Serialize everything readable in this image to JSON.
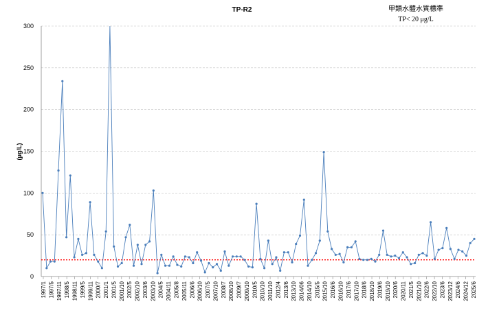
{
  "chart_data": {
    "type": "line",
    "title": "TP-R2",
    "ylabel": "(μg/L)",
    "xlabel": "",
    "ylim": [
      0,
      300
    ],
    "yticks": [
      0,
      50,
      100,
      150,
      200,
      250,
      300
    ],
    "grid": true,
    "standard_note": [
      "甲類水體水質標準",
      "TP< 20 μg/L"
    ],
    "standard_line": {
      "value": 20
    },
    "colors": {
      "series": "#4a7ebb",
      "standard": "#ff0000",
      "grid": "#c0c0c0"
    },
    "x_tick_labels": [
      "1997/1",
      "1997/5",
      "1997/11",
      "1998/5",
      "1998/11",
      "1999/5",
      "1999/11",
      "2000/7",
      "2001/1",
      "2001/5",
      "2001/10",
      "2002/5",
      "2002/10",
      "2003/6",
      "2003/10",
      "2004/5",
      "2004/11",
      "2005/8",
      "2005/11",
      "2006/6",
      "2006/10",
      "2007/5",
      "2007/10",
      "2008/7",
      "2008/10",
      "2009/7",
      "2009/10",
      "2010/5",
      "2010/10",
      "2011/10",
      "2012/4",
      "2013/6",
      "2013/10",
      "2014/06",
      "2014/10",
      "2015/5",
      "2015/10",
      "2016/6",
      "2016/10",
      "2017/6",
      "2017/10",
      "2018/6",
      "2018/10",
      "2019/6",
      "2019/10",
      "2020/6",
      "2020/11",
      "2021/5",
      "2021/10",
      "2022/6",
      "2022/10",
      "2023/6",
      "2023/12",
      "2024/6",
      "2024/12",
      "2025/6"
    ],
    "values": [
      100,
      10,
      18,
      18,
      127,
      234,
      47,
      121,
      23,
      45,
      26,
      28,
      89,
      26,
      18,
      10,
      54,
      340,
      36,
      12,
      16,
      47,
      62,
      13,
      38,
      15,
      38,
      42,
      103,
      4,
      26,
      13,
      13,
      24,
      14,
      12,
      24,
      23,
      16,
      29,
      19,
      5,
      16,
      11,
      15,
      7,
      30,
      13,
      24,
      24,
      24,
      20,
      12,
      11,
      87,
      21,
      10,
      43,
      15,
      23,
      7,
      29,
      29,
      17,
      39,
      49,
      92,
      13,
      20,
      28,
      43,
      149,
      54,
      33,
      26,
      27,
      17,
      35,
      35,
      42,
      21,
      20,
      20,
      21,
      18,
      26,
      55,
      26,
      24,
      25,
      22,
      29,
      23,
      15,
      16,
      26,
      28,
      25,
      65,
      21,
      32,
      34,
      58,
      33,
      21,
      32,
      30,
      25,
      40,
      45
    ]
  }
}
